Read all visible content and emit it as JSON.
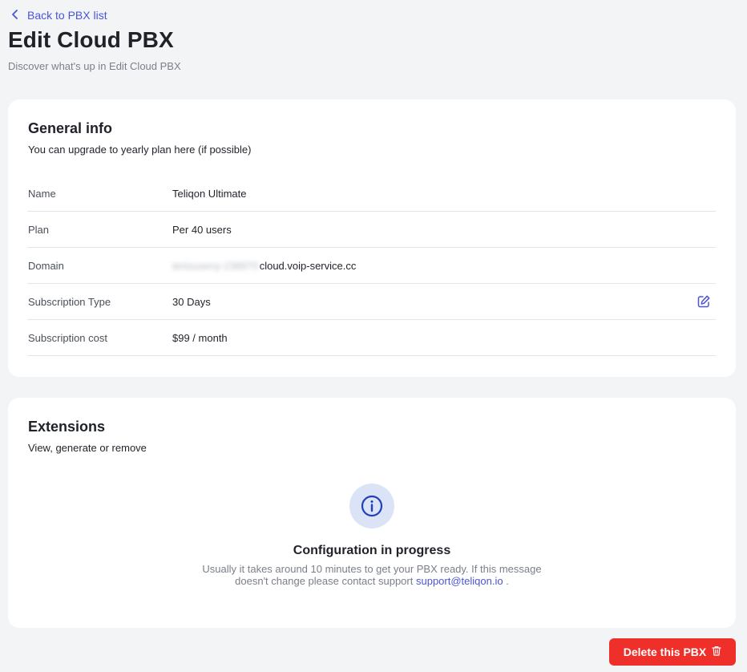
{
  "header": {
    "back_label": "Back to PBX list",
    "title": "Edit Cloud PBX",
    "subtitle": "Discover what's up in Edit Cloud PBX"
  },
  "general_info": {
    "title": "General info",
    "description": "You can upgrade to yearly plan here (if possible)",
    "rows": [
      {
        "label": "Name",
        "value": "Teliqon Ultimate"
      },
      {
        "label": "Plan",
        "value": "Per 40 users"
      },
      {
        "label": "Domain",
        "value_hidden": "teriouseny-238970",
        "value": "cloud.voip-service.cc"
      },
      {
        "label": "Subscription Type",
        "value": "30 Days"
      },
      {
        "label": "Subscription cost",
        "value": "$99 / month"
      }
    ]
  },
  "extensions": {
    "title": "Extensions",
    "description": "View, generate or remove",
    "status_title": "Configuration in progress",
    "status_line1": "Usually it takes around 10 minutes to get your PBX ready. If this message",
    "status_line2": "doesn't change please contact support",
    "support_email": "support@teliqon.io",
    "status_end": "."
  },
  "actions": {
    "delete_label": "Delete this PBX"
  },
  "colors": {
    "accent": "#4b55d6",
    "danger": "#ee2f2a",
    "background": "#f3f4f6",
    "card": "#ffffff",
    "info_badge": "#dbe3f6",
    "info_icon": "#1f3fbf"
  },
  "icons": {
    "back": "chevron-left-icon",
    "edit": "edit-icon",
    "info": "info-icon",
    "delete": "trash-icon"
  }
}
